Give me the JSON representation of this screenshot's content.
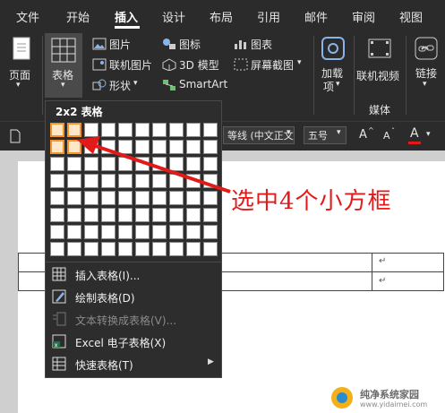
{
  "menu": {
    "tabs": [
      "文件",
      "开始",
      "插入",
      "设计",
      "布局",
      "引用",
      "邮件",
      "审阅",
      "视图"
    ],
    "active": "插入"
  },
  "ribbon": {
    "page_label": "页面",
    "table_label": "表格",
    "picture_label": "图片",
    "online_picture_label": "联机图片",
    "shapes_label": "形状",
    "icons_label": "图标",
    "model3d_label": "3D 模型",
    "smartart_label": "SmartArt",
    "chart_label": "图表",
    "screenshot_label": "屏幕截图",
    "addins_label_1": "加载",
    "addins_label_2": "项",
    "online_video_label": "联机视频",
    "media_group_label": "媒体",
    "link_label": "链接"
  },
  "format_bar": {
    "font_name": "等线 (中文正文)",
    "font_size": "五号",
    "grow_font": "A",
    "shrink_font": "A",
    "font_color": "A"
  },
  "table_dropdown": {
    "title": "2x2 表格",
    "grid_rows": 8,
    "grid_cols": 10,
    "selected_rows": 2,
    "selected_cols": 2,
    "items": [
      {
        "label": "插入表格(I)...",
        "icon": "table-grid-icon",
        "enabled": true
      },
      {
        "label": "绘制表格(D)",
        "icon": "pencil-table-icon",
        "enabled": true
      },
      {
        "label": "文本转换成表格(V)...",
        "icon": "text-to-table-icon",
        "enabled": false
      },
      {
        "label": "Excel 电子表格(X)",
        "icon": "excel-icon",
        "enabled": true
      },
      {
        "label": "快速表格(T)",
        "icon": "quick-table-icon",
        "enabled": true
      }
    ]
  },
  "annotation": {
    "text": "选中4个小方框",
    "color": "#e21a1a"
  },
  "document": {
    "paragraph_marks": [
      "↵",
      "↵"
    ]
  },
  "watermark": {
    "text": "纯净系统家园",
    "url": "www.yidaimei.com"
  },
  "colors": {
    "ribbon_bg": "#2b2b2b",
    "selection": "#f5922a",
    "arrow": "#e21a1a",
    "font_color_underline": "#e21a1a"
  }
}
